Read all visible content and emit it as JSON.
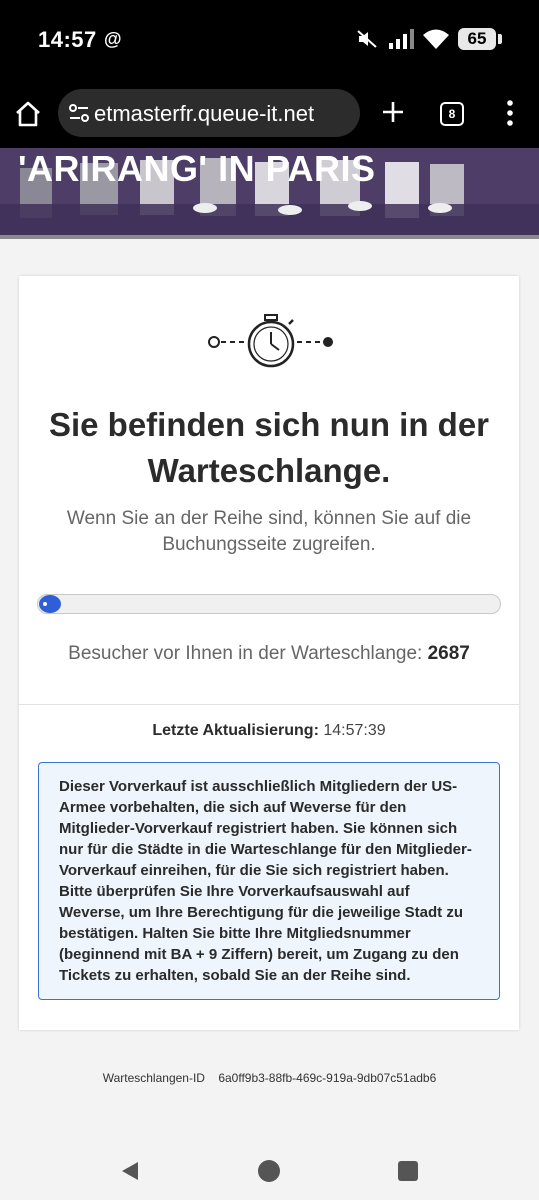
{
  "status_bar": {
    "time": "14:57",
    "battery": "65",
    "threads_glyph": "@"
  },
  "browser": {
    "url": "etmasterfr.queue-it.net",
    "tab_count": "8"
  },
  "banner": {
    "title": "'ARIRANG' IN PARIS"
  },
  "queue": {
    "headline": "Sie befinden sich nun in der Warteschlange.",
    "subtext": "Wenn Sie an der Reihe sind, können Sie auf die Buchungsseite zugreifen.",
    "ahead_label": "Besucher vor Ihnen in der Warteschlange:",
    "ahead_count": "2687",
    "progress_fraction": 0.02,
    "last_update_label": "Letzte Aktualisierung:",
    "last_update_time": "14:57:39",
    "info_message": "Dieser Vorverkauf ist ausschließlich Mitgliedern der US-Armee vorbehalten, die sich auf Weverse für den Mitglieder-Vorverkauf registriert haben. Sie können sich nur für die Städte in die Warteschlange für den Mitglieder-Vorverkauf einreihen, für die Sie sich registriert haben. Bitte überprüfen Sie Ihre Vorverkaufsauswahl auf Weverse, um Ihre Berechtigung für die jeweilige Stadt zu bestätigen. Halten Sie bitte Ihre Mitgliedsnummer (beginnend mit BA + 9 Ziffern) bereit, um Zugang zu den Tickets zu erhalten, sobald Sie an der Reihe sind."
  },
  "footer": {
    "queue_id_label": "Warteschlangen-ID",
    "queue_id_value": "6a0ff9b3-88fb-469c-919a-9db07c51adb6"
  },
  "colors": {
    "accent": "#2f5fd6",
    "info_border": "#3a73d6",
    "info_background": "#eef5fc",
    "banner": "#4d3c63"
  },
  "icons": [
    "threads-icon",
    "mute-icon",
    "signal-icon",
    "wifi-icon",
    "home-icon",
    "site-settings-icon",
    "new-tab-icon",
    "tabs-icon",
    "menu-icon",
    "stopwatch-icon",
    "back-icon",
    "nav-home-icon",
    "recents-icon"
  ]
}
